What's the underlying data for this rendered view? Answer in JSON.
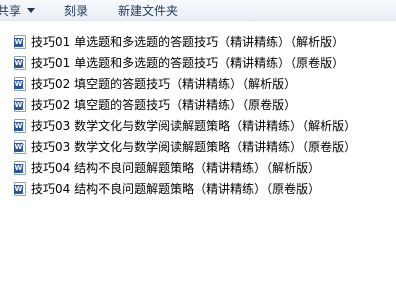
{
  "toolbar": {
    "share_label": "共享",
    "burn_label": "刻录",
    "new_folder_label": "新建文件夹"
  },
  "files": [
    {
      "name": "技巧01 单选题和多选题的答题技巧（精讲精练）（解析版）",
      "icon": "word-document-icon"
    },
    {
      "name": "技巧01 单选题和多选题的答题技巧（精讲精练）（原卷版）",
      "icon": "word-document-icon"
    },
    {
      "name": "技巧02 填空题的答题技巧（精讲精练）（解析版）",
      "icon": "word-document-icon"
    },
    {
      "name": "技巧02 填空题的答题技巧（精讲精练）（原卷版）",
      "icon": "word-document-icon"
    },
    {
      "name": "技巧03 数学文化与数学阅读解题策略（精讲精练）（解析版）",
      "icon": "word-document-icon"
    },
    {
      "name": "技巧03 数学文化与数学阅读解题策略（精讲精练）（原卷版）",
      "icon": "word-document-icon"
    },
    {
      "name": "技巧04 结构不良问题解题策略（精讲精练）（解析版）",
      "icon": "word-document-icon"
    },
    {
      "name": "技巧04 结构不良问题解题策略（精讲精练）（原卷版）",
      "icon": "word-document-icon"
    }
  ],
  "colors": {
    "toolbar_text": "#1e395b",
    "word_icon": "#2b5797"
  }
}
